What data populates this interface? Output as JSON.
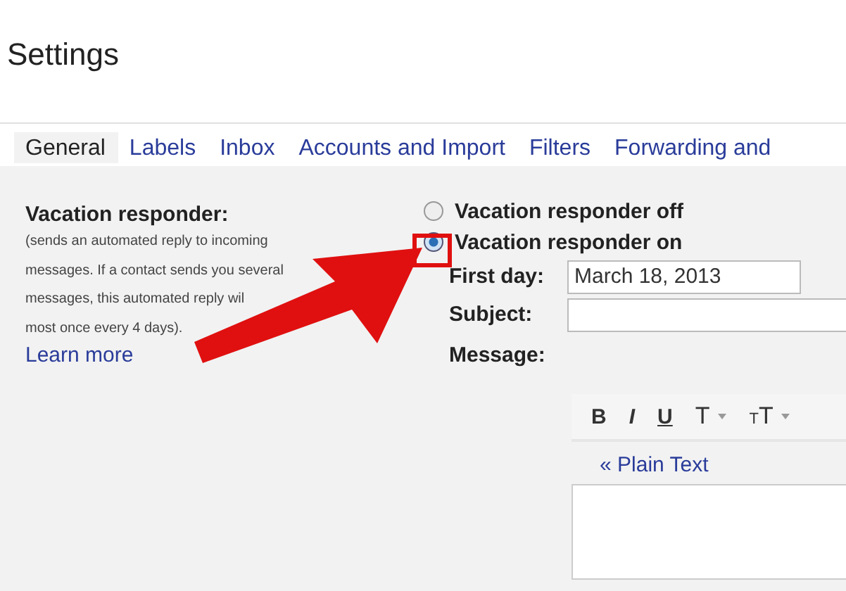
{
  "page": {
    "title": "Settings"
  },
  "tabs": [
    {
      "label": "General",
      "selected": true
    },
    {
      "label": "Labels",
      "selected": false
    },
    {
      "label": "Inbox",
      "selected": false
    },
    {
      "label": "Accounts and Import",
      "selected": false
    },
    {
      "label": "Filters",
      "selected": false
    },
    {
      "label": "Forwarding and",
      "selected": false
    }
  ],
  "section": {
    "heading": "Vacation responder:",
    "description_lines": [
      "(sends an automated reply to incoming",
      "messages. If a contact sends you several",
      "messages, this automated reply wil",
      "most once every 4 days)."
    ],
    "link": "Learn more"
  },
  "responder_options": [
    {
      "label": "Vacation responder off",
      "selected": false
    },
    {
      "label": "Vacation responder on",
      "selected": true
    }
  ],
  "fields": [
    {
      "label": "First day:",
      "value": "March 18, 2013"
    },
    {
      "label": "Subject:"
    }
  ],
  "message_label": "Message:",
  "toolbar": [
    {
      "label": "B",
      "kind": "bold"
    },
    {
      "label": "I",
      "kind": "italic"
    },
    {
      "label": "U",
      "kind": "underline"
    },
    {
      "label": "T",
      "kind": "font",
      "dropdown": true
    },
    {
      "label": "TT",
      "kind": "size",
      "dropdown": true
    }
  ],
  "plain_text_link": "« Plain Text",
  "annotations": {
    "arrow": true,
    "highlight": true
  }
}
